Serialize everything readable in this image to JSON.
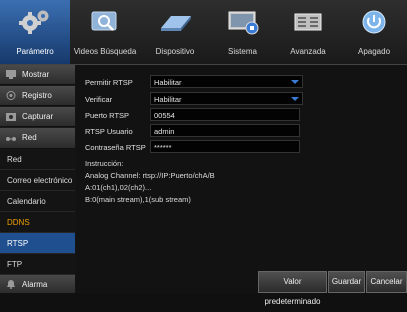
{
  "toolbar": {
    "items": [
      {
        "label": "Parámetro",
        "icon": "gears-icon",
        "active": true
      },
      {
        "label": "Videos Búsqueda",
        "icon": "video-search-icon",
        "active": false
      },
      {
        "label": "Dispositivo",
        "icon": "hard-drive-icon",
        "active": false
      },
      {
        "label": "Sistema",
        "icon": "system-monitor-icon",
        "active": false
      },
      {
        "label": "Avanzada",
        "icon": "advanced-panel-icon",
        "active": false
      },
      {
        "label": "Apagado",
        "icon": "power-icon",
        "active": false
      }
    ]
  },
  "sidebar": {
    "mostrar": "Mostrar",
    "registro": "Registro",
    "capturar": "Capturar",
    "red": "Red",
    "sub": {
      "red": "Red",
      "correo": "Correo electrónico",
      "calendario": "Calendario",
      "ddns": "DDNS",
      "rtsp": "RTSP",
      "ftp": "FTP"
    },
    "alarma": "Alarma"
  },
  "form": {
    "permitir_rtsp": {
      "label": "Permitir RTSP",
      "value": "Habilitar"
    },
    "verificar": {
      "label": "Verificar",
      "value": "Habilitar"
    },
    "puerto_rtsp": {
      "label": "Puerto RTSP",
      "value": "00554"
    },
    "rtsp_usuario": {
      "label": "RTSP Usuario",
      "value": "admin"
    },
    "contrasena_rtsp": {
      "label": "Contraseña RTSP",
      "value": "******"
    }
  },
  "instructions": {
    "title": "Instrucción:",
    "line1": "Analog Channel:  rtsp://IP:Puerto/chA/B",
    "line2": "A:01(ch1),02(ch2)...",
    "line3": "B:0(main stream),1(sub stream)"
  },
  "buttons": {
    "default": "Valor predeterminado",
    "save": "Guardar",
    "cancel": "Cancelar"
  },
  "colors": {
    "accent": "#1f4f8e",
    "highlight": "#f0a000",
    "dropdown_arrow": "#3a7bd5"
  }
}
